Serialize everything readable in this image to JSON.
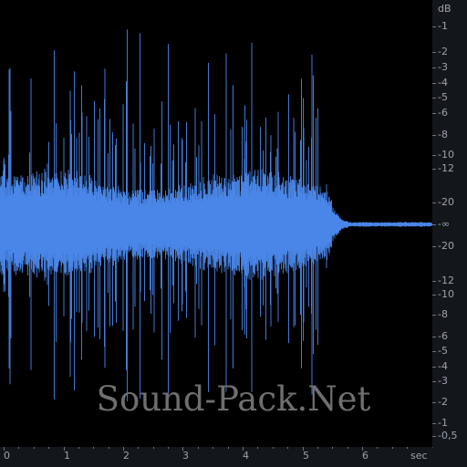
{
  "colors": {
    "waveform": "#4a86e8",
    "background": "#000000",
    "panel": "#13171b",
    "labels": "#9aa3ad"
  },
  "db_scale": {
    "unit": "dB",
    "labels_top": [
      "-1",
      "-2",
      "-3",
      "-4",
      "-5",
      "-6",
      "-8",
      "-10",
      "-12",
      "-20"
    ],
    "center": "-∞",
    "labels_bottom": [
      "-20",
      "-12",
      "-10",
      "-8",
      "-6",
      "-5",
      "-4",
      "-3",
      "-2",
      "-1",
      "-0,5"
    ]
  },
  "time_scale": {
    "unit": "sec",
    "labels": [
      "0",
      "1",
      "2",
      "3",
      "4",
      "5",
      "6"
    ]
  },
  "watermark": "Sound-Pack.Net",
  "waveform_info": {
    "duration_sec": 7.2,
    "decay_start_sec": 5.4,
    "silence_after_sec": 5.8
  }
}
